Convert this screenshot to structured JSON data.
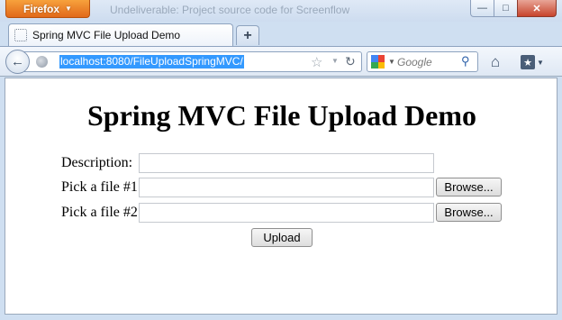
{
  "window": {
    "app_button_label": "Firefox",
    "title": "Undeliverable: Project source code for Screenflow",
    "controls": {
      "minimize": "—",
      "maximize": "□",
      "close": "✕"
    }
  },
  "tabs": [
    {
      "title": "Spring MVC File Upload Demo"
    }
  ],
  "new_tab_label": "+",
  "navigation": {
    "back_glyph": "←",
    "url": "localhost:8080/FileUploadSpringMVC/",
    "search_placeholder": "Google",
    "icons": [
      "globe-icon",
      "star-icon",
      "reload-icon",
      "google-logo-icon",
      "magnifier-icon",
      "home-icon",
      "bookmarks-icon"
    ]
  },
  "page": {
    "heading": "Spring MVC File Upload Demo",
    "form": {
      "description_label": "Description:",
      "description_value": "",
      "file1_label": "Pick a file #1:",
      "file1_value": "",
      "file2_label": "Pick a file #2:",
      "file2_value": "",
      "browse_label": "Browse...",
      "upload_label": "Upload"
    }
  },
  "colors": {
    "firefox_button": "#e97d24",
    "url_selection": "#3399ff",
    "frame": "#cfdff1"
  }
}
